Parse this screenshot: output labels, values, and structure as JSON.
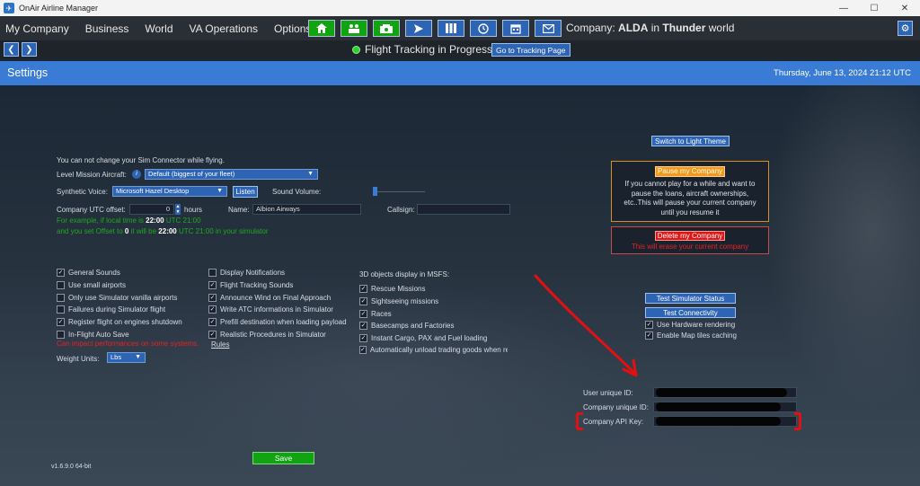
{
  "window": {
    "title": "OnAir Airline Manager",
    "controls": [
      "—",
      "☐",
      "✕"
    ]
  },
  "menu": {
    "items": [
      "My Company",
      "Business",
      "World",
      "VA Operations",
      "Options"
    ],
    "toolbar_icons": [
      {
        "name": "home-icon",
        "glyph": "⌂",
        "color": "green"
      },
      {
        "name": "crew-icon",
        "glyph": "♟",
        "color": "green"
      },
      {
        "name": "cash-icon",
        "glyph": "$",
        "color": "green"
      },
      {
        "name": "flight-icon",
        "glyph": "✈",
        "color": "blue"
      },
      {
        "name": "map-icon",
        "glyph": "▥",
        "color": "blue"
      },
      {
        "name": "clock-icon",
        "glyph": "◷",
        "color": "blue"
      },
      {
        "name": "calendar-icon",
        "glyph": "▦",
        "color": "blue"
      },
      {
        "name": "mail-icon",
        "glyph": "✉",
        "color": "blue"
      }
    ],
    "company_prefix": "Company:",
    "company_name": "ALDA",
    "company_in": "in",
    "world_name": "Thunder",
    "world_suffix": "world",
    "gear_icon": "⚙"
  },
  "nav": {
    "back_glyph": "❮",
    "forward_glyph": "❯",
    "tracking_text": "Flight Tracking in Progress",
    "goto_button": "Go to Tracking Page"
  },
  "settings": {
    "title": "Settings",
    "date": "Thursday, June 13, 2024 21:12 UTC",
    "sim_connector_note": "You can not change your Sim Connector while flying.",
    "level_mission_label": "Level Mission Aircraft:",
    "level_mission_value": "Default (biggest of your fleet)",
    "info_icon": "i",
    "voice_label": "Synthetic Voice:",
    "voice_value": "Microsoft Hazel Desktop",
    "listen_button": "Listen",
    "sound_volume_label": "Sound Volume:",
    "utc_offset_label": "Company UTC offset:",
    "utc_offset_value": "0",
    "hours_label": "hours",
    "name_label": "Name:",
    "name_value": "Albion Airways",
    "callsign_label": "Callsign:",
    "callsign_value": "",
    "example_line1_a": "For example, if local time is",
    "example_line1_b": "22:00",
    "example_line1_c": "UTC 21:00",
    "example_line2_a": "and you set Offset to",
    "example_line2_b": "0",
    "example_line2_c": "it will be",
    "example_line2_d": "22:00",
    "example_line2_e": "UTC 21:00 in your simulator",
    "switch_theme_button": "Switch to Light Theme",
    "pause_button": "Pause my Company",
    "pause_text": "If you cannot play for a while and want to pause the loans, aircraft ownerships, etc..This will pause your current company until you resume it",
    "delete_button": "Delete my Company",
    "delete_text": "This will erase your current company",
    "col1": [
      {
        "label": "General Sounds",
        "checked": true
      },
      {
        "label": "Use small airports",
        "checked": false
      },
      {
        "label": "Only use Simulator vanilla airports",
        "checked": false
      },
      {
        "label": "Failures during Simulator flight",
        "checked": false
      },
      {
        "label": "Register flight on engines shutdown",
        "checked": true
      },
      {
        "label": "In-Flight Auto Save",
        "checked": false
      }
    ],
    "auto_save_warning": "Can impact performances on some systems.",
    "weight_units_label": "Weight Units:",
    "weight_units_value": "Lbs",
    "col2": [
      {
        "label": "Display Notifications",
        "checked": false
      },
      {
        "label": "Flight Tracking Sounds",
        "checked": true
      },
      {
        "label": "Announce Wind on Final Approach",
        "checked": true
      },
      {
        "label": "Write ATC informations in Simulator",
        "checked": true
      },
      {
        "label": "Prefill destination when loading payload",
        "checked": true
      },
      {
        "label": "Realistic Procedures in Simulator",
        "checked": true
      }
    ],
    "rules_link": "Rules",
    "col3_title": "3D objects display in MSFS:",
    "col3": [
      {
        "label": "Rescue Missions",
        "checked": true
      },
      {
        "label": "Sightseeing missions",
        "checked": true
      },
      {
        "label": "Races",
        "checked": true
      },
      {
        "label": "Basecamps and Factories",
        "checked": true
      },
      {
        "label": "Instant Cargo, PAX and Fuel loading",
        "checked": true
      },
      {
        "label": "Automatically unload trading goods when re",
        "checked": true
      }
    ],
    "test_sim_button": "Test Simulator Status",
    "test_conn_button": "Test Connectivity",
    "col4": [
      {
        "label": "Use Hardware rendering",
        "checked": true
      },
      {
        "label": "Enable Map tiles caching",
        "checked": true
      }
    ],
    "user_id_label": "User unique ID:",
    "company_id_label": "Company unique ID:",
    "api_key_label": "Company API Key:",
    "save_button": "Save",
    "version": "v1.6.9.0 64-bit"
  },
  "colors": {
    "accent_blue": "#3a7bd5",
    "button_blue": "#2d64b4",
    "button_green": "#10a410",
    "annotation_red": "#e41010",
    "pause_orange": "#f39a1a"
  }
}
